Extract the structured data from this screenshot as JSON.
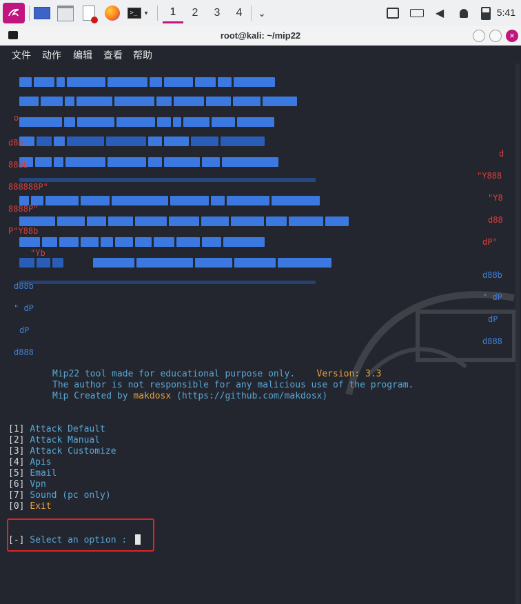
{
  "taskbar": {
    "workspaces": [
      "1",
      "2",
      "3",
      "4"
    ],
    "active_workspace": "1",
    "clock": "5:41",
    "accent": "#c0157e"
  },
  "window": {
    "title": "root@kali: ~/mip22",
    "menu": [
      "文件",
      "动作",
      "编辑",
      "查看",
      "帮助"
    ]
  },
  "terminal": {
    "banner_side_text": {
      "left": [
        "o",
        "d8b",
        "888b",
        "888888P\"",
        "8888P\"",
        "P\"Y88b",
        "\"Yb",
        "d88b",
        "\" dP",
        "dP",
        "d888"
      ],
      "right": [
        "d",
        "\"Y888",
        "\"Y8",
        "d88",
        "dP\"",
        "d88b",
        "\" dP",
        "dP",
        "d888"
      ]
    },
    "info": {
      "line1": "Mip22 tool made for educational purpose only.",
      "version": "Version: 3.3",
      "line2": "The author is not responsible for any malicious use of the program.",
      "line3_prefix": "Mip Created by ",
      "author": "makdosx",
      "line3_suffix": " (https://github.com/makdosx)"
    },
    "options": [
      {
        "key": "[1]",
        "label": "Attack Default"
      },
      {
        "key": "[2]",
        "label": "Attack Manual"
      },
      {
        "key": "[3]",
        "label": "Attack Customize"
      },
      {
        "key": "[4]",
        "label": "Apis"
      },
      {
        "key": "[5]",
        "label": "Email"
      },
      {
        "key": "[6]",
        "label": "Vpn"
      },
      {
        "key": "[7]",
        "label": "Sound (pc only)"
      },
      {
        "key": "[0]",
        "label": "Exit"
      }
    ],
    "prompt_marker": "[-]",
    "prompt_text": " Select an option : "
  }
}
